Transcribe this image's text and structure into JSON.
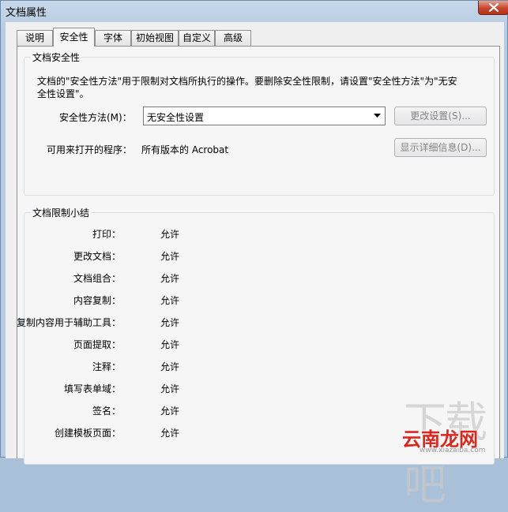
{
  "window": {
    "title": "文档属性"
  },
  "tabs": [
    {
      "label": "说明"
    },
    {
      "label": "安全性"
    },
    {
      "label": "字体"
    },
    {
      "label": "初始视图"
    },
    {
      "label": "自定义"
    },
    {
      "label": "高级"
    }
  ],
  "active_tab": "安全性",
  "security": {
    "group_title": "文档安全性",
    "description": "文档的\"安全性方法\"用于限制对文档所执行的操作。要删除安全性限制，请设置\"安全性方法\"为\"无安全性设置\"。",
    "method_label": "安全性方法(M)：",
    "method_value": "无安全性设置",
    "change_settings_button": "更改设置(S)...",
    "open_with_label": "可用来打开的程序：",
    "open_with_value": "所有版本的 Acrobat",
    "show_details_button": "显示详细信息(D)..."
  },
  "summary": {
    "group_title": "文档限制小结",
    "rows": [
      {
        "label": "打印：",
        "value": "允许"
      },
      {
        "label": "更改文档：",
        "value": "允许"
      },
      {
        "label": "文档组合：",
        "value": "允许"
      },
      {
        "label": "内容复制：",
        "value": "允许"
      },
      {
        "label": "复制内容用于辅助工具：",
        "value": "允许"
      },
      {
        "label": "页面提取：",
        "value": "允许"
      },
      {
        "label": "注释：",
        "value": "允许"
      },
      {
        "label": "填写表单域：",
        "value": "允许"
      },
      {
        "label": "签名：",
        "value": "允许"
      },
      {
        "label": "创建模板页面：",
        "value": "允许"
      }
    ]
  },
  "watermark": {
    "brand": "云南龙网",
    "url": "www.xiazaiba.com"
  },
  "colors": {
    "titlebar": "#c7d8ea",
    "close_button": "#c8452d",
    "dialog_bg": "#f6f6f6",
    "disabled_text": "#838383",
    "watermark_brand": "#e1251b"
  }
}
